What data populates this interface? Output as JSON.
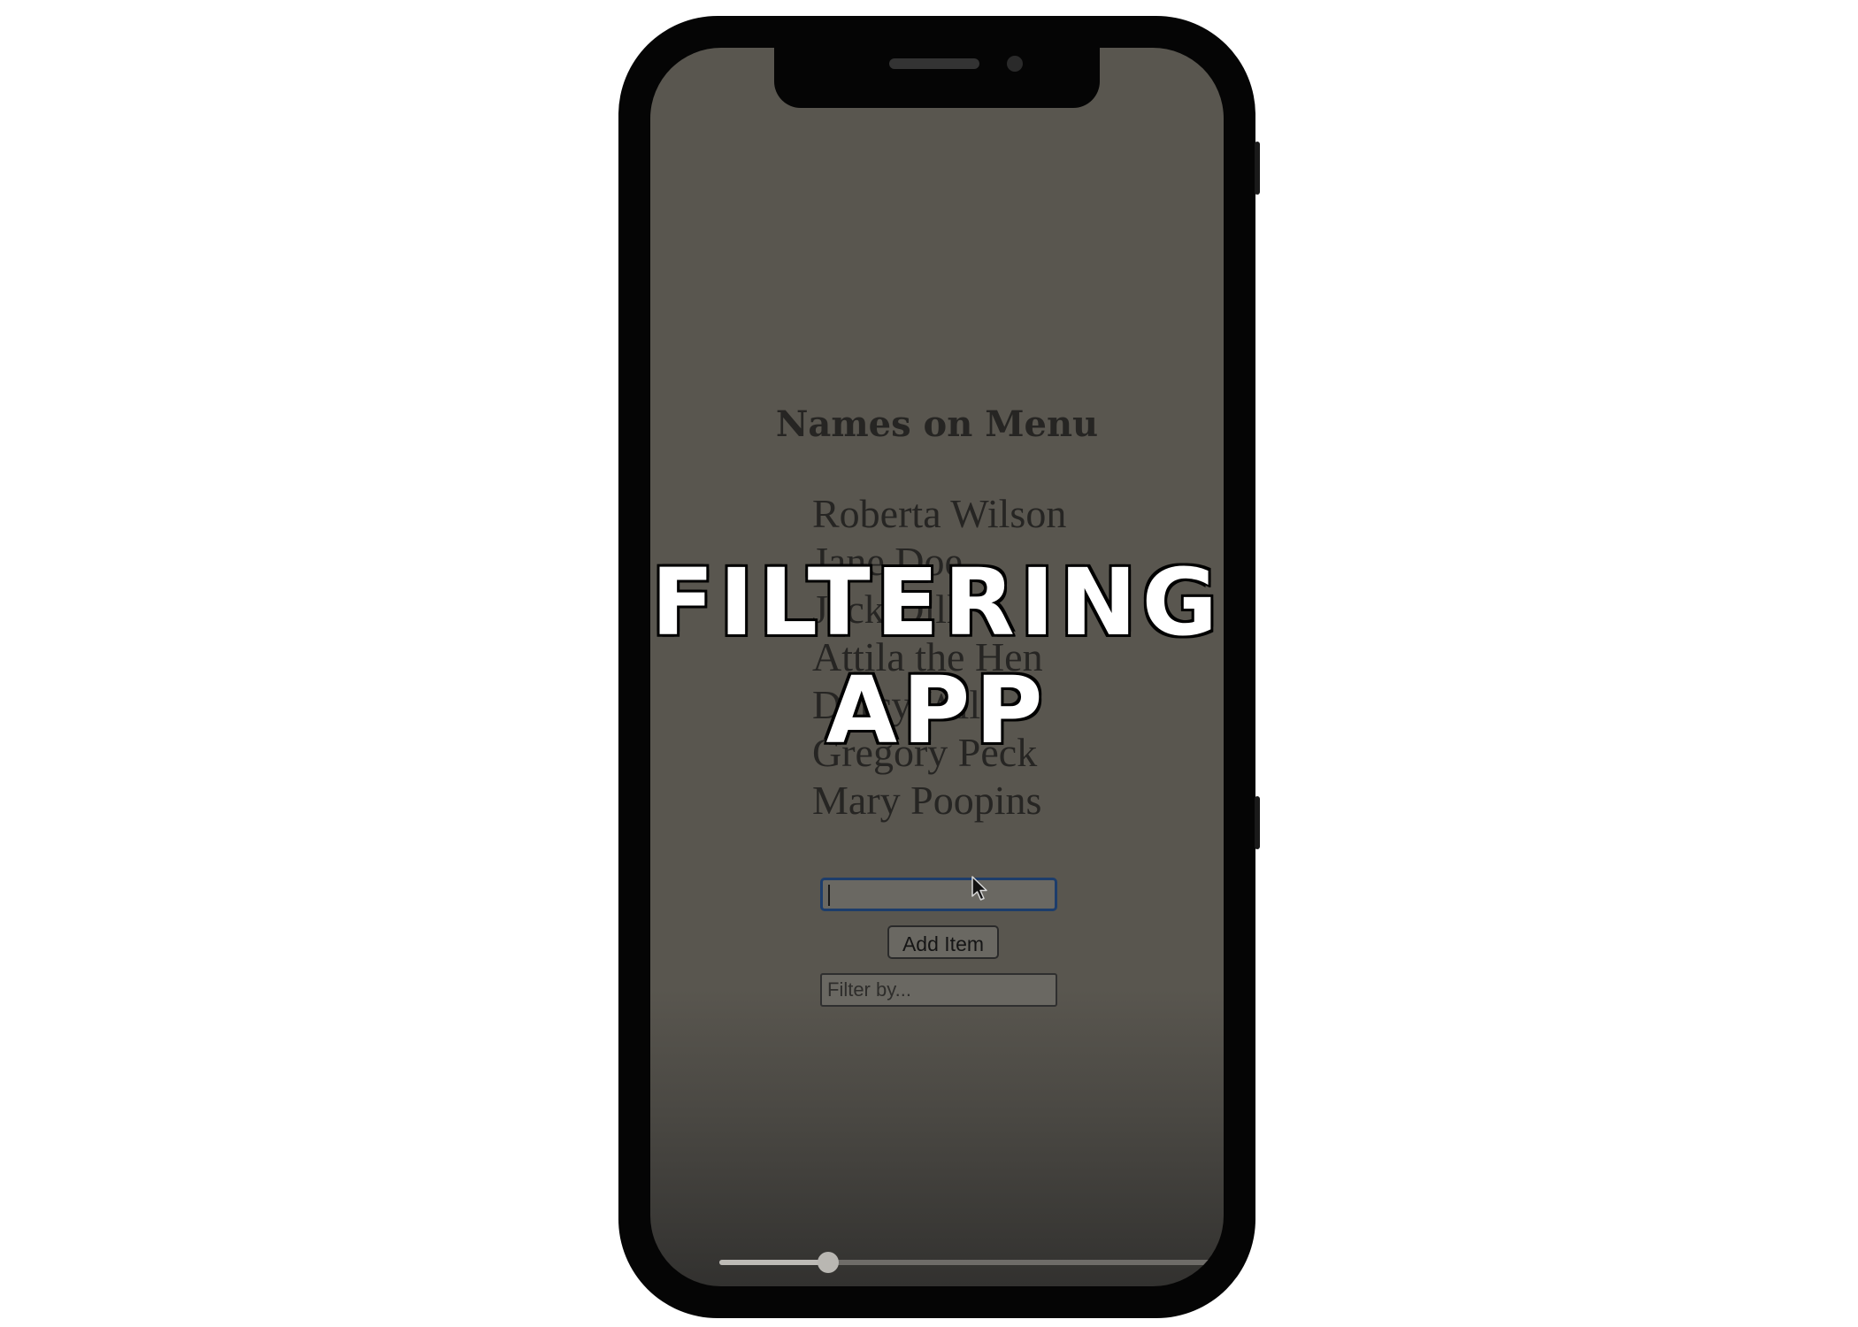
{
  "app": {
    "heading": "Names on Menu",
    "names": [
      "Roberta Wilson",
      "Jane Doe",
      "Jack Dill",
      "Attila the Hen",
      "Darcy Will",
      "Gregory Peck",
      "Mary Poopins"
    ],
    "add_item_input_value": "",
    "add_button_label": "Add Item",
    "filter_placeholder": "Filter by..."
  },
  "overlay": {
    "line1": "FILTERING",
    "line2": "APP"
  },
  "video_progress": 0.22,
  "colors": {
    "screen_bg": "#59564f",
    "text": "#262523",
    "focus_border": "#1d3d6b"
  }
}
